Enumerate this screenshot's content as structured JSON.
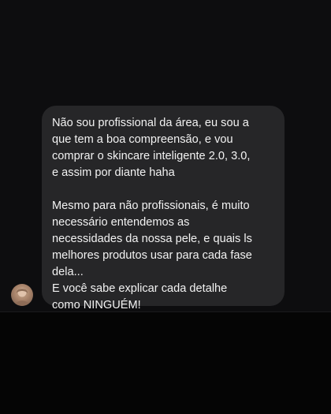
{
  "message": {
    "paragraphs": [
      "Não sou profissional da área, eu sou a\nque tem a boa compreensão, e vou\ncomprar o skincare inteligente 2.0, 3.0,\ne assim por diante haha",
      "Mesmo para não profissionais, é muito\nnecessário entendemos as\nnecessidades da nossa pele, e quais ls\nmelhores produtos usar para cada fase\ndela...",
      "E você sabe explicar cada detalhe\ncomo NINGUÉM!"
    ]
  },
  "sender": {
    "avatar_icon": "user-avatar"
  },
  "colors": {
    "background": "#0d0d0f",
    "bubble": "#262628",
    "text": "#f2f2f2"
  }
}
